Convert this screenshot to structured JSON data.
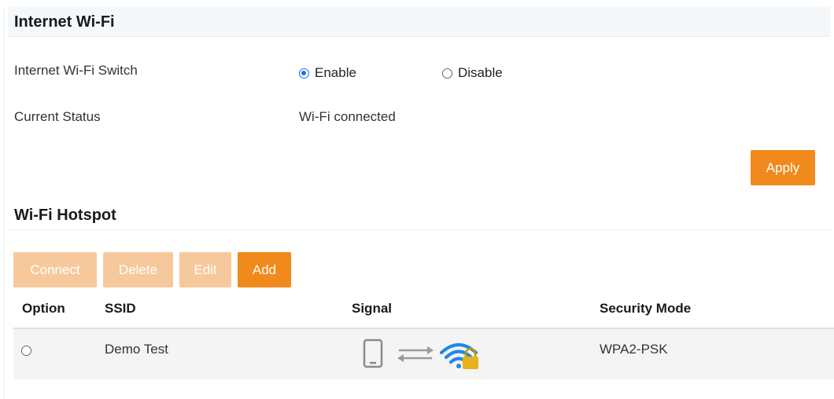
{
  "internet_wifi": {
    "title": "Internet Wi-Fi",
    "switch_label": "Internet Wi-Fi Switch",
    "enable_label": "Enable",
    "disable_label": "Disable",
    "selected": "Enable",
    "status_label": "Current Status",
    "status_value": "Wi-Fi connected",
    "apply_label": "Apply"
  },
  "hotspot": {
    "title": "Wi-Fi Hotspot",
    "buttons": {
      "connect": "Connect",
      "delete": "Delete",
      "edit": "Edit",
      "add": "Add"
    },
    "columns": [
      "Option",
      "SSID",
      "Signal",
      "Security Mode"
    ],
    "rows": [
      {
        "selected": false,
        "ssid": "Demo Test",
        "signal_icons": [
          "phone-icon",
          "transfer-arrows-icon",
          "wifi-locked-icon"
        ],
        "security": "WPA2-PSK"
      }
    ]
  },
  "colors": {
    "accent": "#f08a1c",
    "accent_disabled": "#f6c99c",
    "radio_checked": "#1a73e8"
  }
}
